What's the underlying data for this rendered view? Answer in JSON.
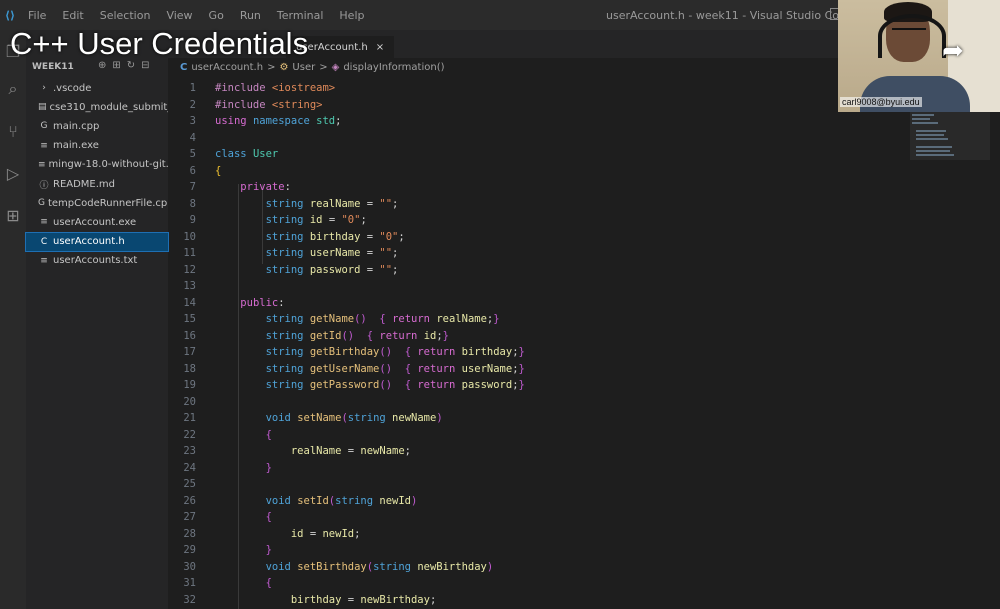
{
  "menu": [
    "File",
    "Edit",
    "Selection",
    "View",
    "Go",
    "Run",
    "Terminal",
    "Help"
  ],
  "window_title": "userAccount.h - week11 - Visual Studio Code",
  "overlay_title": "C++ User Credentials",
  "tab": {
    "label": "userAccount.h",
    "close": "×"
  },
  "breadcrumb": {
    "file": "userAccount.h",
    "sep": ">",
    "class": "User",
    "method": "displayInformation()"
  },
  "explorer": {
    "section": "WEEK11",
    "files": [
      {
        "name": ".vscode",
        "icon": "›"
      },
      {
        "name": "cse310_module_submit_c...",
        "icon": "▤"
      },
      {
        "name": "main.cpp",
        "icon": "G"
      },
      {
        "name": "main.exe",
        "icon": "≡"
      },
      {
        "name": "mingw-18.0-without-git...",
        "icon": "≡"
      },
      {
        "name": "README.md",
        "icon": "ⓘ"
      },
      {
        "name": "tempCodeRunnerFile.cpp",
        "icon": "G"
      },
      {
        "name": "userAccount.exe",
        "icon": "≡"
      },
      {
        "name": "userAccount.h",
        "icon": "C",
        "selected": true
      },
      {
        "name": "userAccounts.txt",
        "icon": "≡"
      }
    ]
  },
  "code_lines": [
    {
      "n": "1",
      "html": [
        [
          "pp",
          "#include "
        ],
        [
          "str",
          "<iostream>"
        ]
      ]
    },
    {
      "n": "2",
      "html": [
        [
          "pp",
          "#include "
        ],
        [
          "str",
          "<string>"
        ]
      ]
    },
    {
      "n": "3",
      "html": [
        [
          "kw",
          "using "
        ],
        [
          "ty",
          "namespace "
        ],
        [
          "cls",
          "std"
        ],
        [
          "plain",
          ";"
        ]
      ]
    },
    {
      "n": "4",
      "html": []
    },
    {
      "n": "5",
      "html": [
        [
          "ty",
          "class "
        ],
        [
          "cls",
          "User"
        ]
      ]
    },
    {
      "n": "6",
      "html": [
        [
          "br",
          "{"
        ]
      ]
    },
    {
      "n": "7",
      "html": [
        [
          "plain",
          "    "
        ],
        [
          "kw",
          "private"
        ],
        [
          "plain",
          ":"
        ]
      ]
    },
    {
      "n": "8",
      "html": [
        [
          "plain",
          "        "
        ],
        [
          "ty",
          "string "
        ],
        [
          "var",
          "realName"
        ],
        [
          "plain",
          " = "
        ],
        [
          "str",
          "\"\""
        ],
        [
          "plain",
          ";"
        ]
      ]
    },
    {
      "n": "9",
      "html": [
        [
          "plain",
          "        "
        ],
        [
          "ty",
          "string "
        ],
        [
          "var",
          "id"
        ],
        [
          "plain",
          " = "
        ],
        [
          "str",
          "\"0\""
        ],
        [
          "plain",
          ";"
        ]
      ]
    },
    {
      "n": "10",
      "html": [
        [
          "plain",
          "        "
        ],
        [
          "ty",
          "string "
        ],
        [
          "var",
          "birthday"
        ],
        [
          "plain",
          " = "
        ],
        [
          "str",
          "\"0\""
        ],
        [
          "plain",
          ";"
        ]
      ]
    },
    {
      "n": "11",
      "html": [
        [
          "plain",
          "        "
        ],
        [
          "ty",
          "string "
        ],
        [
          "var",
          "userName"
        ],
        [
          "plain",
          " = "
        ],
        [
          "str",
          "\"\""
        ],
        [
          "plain",
          ";"
        ]
      ]
    },
    {
      "n": "12",
      "html": [
        [
          "plain",
          "        "
        ],
        [
          "ty",
          "string "
        ],
        [
          "var",
          "password"
        ],
        [
          "plain",
          " = "
        ],
        [
          "str",
          "\"\""
        ],
        [
          "plain",
          ";"
        ]
      ]
    },
    {
      "n": "13",
      "html": []
    },
    {
      "n": "14",
      "html": [
        [
          "plain",
          "    "
        ],
        [
          "kw",
          "public"
        ],
        [
          "plain",
          ":"
        ]
      ]
    },
    {
      "n": "15",
      "html": [
        [
          "plain",
          "        "
        ],
        [
          "ty",
          "string "
        ],
        [
          "fn",
          "getName"
        ],
        [
          "br2",
          "()"
        ],
        [
          "plain",
          "  "
        ],
        [
          "br2",
          "{ "
        ],
        [
          "kw",
          "return "
        ],
        [
          "var",
          "realName"
        ],
        [
          "plain",
          ";"
        ],
        [
          "br2",
          "}"
        ]
      ]
    },
    {
      "n": "16",
      "html": [
        [
          "plain",
          "        "
        ],
        [
          "ty",
          "string "
        ],
        [
          "fn",
          "getId"
        ],
        [
          "br2",
          "()"
        ],
        [
          "plain",
          "  "
        ],
        [
          "br2",
          "{ "
        ],
        [
          "kw",
          "return "
        ],
        [
          "var",
          "id"
        ],
        [
          "plain",
          ";"
        ],
        [
          "br2",
          "}"
        ]
      ]
    },
    {
      "n": "17",
      "html": [
        [
          "plain",
          "        "
        ],
        [
          "ty",
          "string "
        ],
        [
          "fn",
          "getBirthday"
        ],
        [
          "br2",
          "()"
        ],
        [
          "plain",
          "  "
        ],
        [
          "br2",
          "{ "
        ],
        [
          "kw",
          "return "
        ],
        [
          "var",
          "birthday"
        ],
        [
          "plain",
          ";"
        ],
        [
          "br2",
          "}"
        ]
      ]
    },
    {
      "n": "18",
      "html": [
        [
          "plain",
          "        "
        ],
        [
          "ty",
          "string "
        ],
        [
          "fn",
          "getUserName"
        ],
        [
          "br2",
          "()"
        ],
        [
          "plain",
          "  "
        ],
        [
          "br2",
          "{ "
        ],
        [
          "kw",
          "return "
        ],
        [
          "var",
          "userName"
        ],
        [
          "plain",
          ";"
        ],
        [
          "br2",
          "}"
        ]
      ]
    },
    {
      "n": "19",
      "html": [
        [
          "plain",
          "        "
        ],
        [
          "ty",
          "string "
        ],
        [
          "fn",
          "getPassword"
        ],
        [
          "br2",
          "()"
        ],
        [
          "plain",
          "  "
        ],
        [
          "br2",
          "{ "
        ],
        [
          "kw",
          "return "
        ],
        [
          "var",
          "password"
        ],
        [
          "plain",
          ";"
        ],
        [
          "br2",
          "}"
        ]
      ]
    },
    {
      "n": "20",
      "html": []
    },
    {
      "n": "21",
      "html": [
        [
          "plain",
          "        "
        ],
        [
          "ty",
          "void "
        ],
        [
          "fn",
          "setName"
        ],
        [
          "br2",
          "("
        ],
        [
          "ty",
          "string "
        ],
        [
          "var",
          "newName"
        ],
        [
          "br2",
          ")"
        ]
      ]
    },
    {
      "n": "22",
      "html": [
        [
          "plain",
          "        "
        ],
        [
          "br2",
          "{"
        ]
      ]
    },
    {
      "n": "23",
      "html": [
        [
          "plain",
          "            "
        ],
        [
          "var",
          "realName"
        ],
        [
          "plain",
          " = "
        ],
        [
          "var",
          "newName"
        ],
        [
          "plain",
          ";"
        ]
      ]
    },
    {
      "n": "24",
      "html": [
        [
          "plain",
          "        "
        ],
        [
          "br2",
          "}"
        ]
      ]
    },
    {
      "n": "25",
      "html": []
    },
    {
      "n": "26",
      "html": [
        [
          "plain",
          "        "
        ],
        [
          "ty",
          "void "
        ],
        [
          "fn",
          "setId"
        ],
        [
          "br2",
          "("
        ],
        [
          "ty",
          "string "
        ],
        [
          "var",
          "newId"
        ],
        [
          "br2",
          ")"
        ]
      ]
    },
    {
      "n": "27",
      "html": [
        [
          "plain",
          "        "
        ],
        [
          "br2",
          "{"
        ]
      ]
    },
    {
      "n": "28",
      "html": [
        [
          "plain",
          "            "
        ],
        [
          "var",
          "id"
        ],
        [
          "plain",
          " = "
        ],
        [
          "var",
          "newId"
        ],
        [
          "plain",
          ";"
        ]
      ]
    },
    {
      "n": "29",
      "html": [
        [
          "plain",
          "        "
        ],
        [
          "br2",
          "}"
        ]
      ]
    },
    {
      "n": "30",
      "html": [
        [
          "plain",
          "        "
        ],
        [
          "ty",
          "void "
        ],
        [
          "fn",
          "setBirthday"
        ],
        [
          "br2",
          "("
        ],
        [
          "ty",
          "string "
        ],
        [
          "var",
          "newBirthday"
        ],
        [
          "br2",
          ")"
        ]
      ]
    },
    {
      "n": "31",
      "html": [
        [
          "plain",
          "        "
        ],
        [
          "br2",
          "{"
        ]
      ]
    },
    {
      "n": "32",
      "html": [
        [
          "plain",
          "            "
        ],
        [
          "var",
          "birthday"
        ],
        [
          "plain",
          " = "
        ],
        [
          "var",
          "newBirthday"
        ],
        [
          "plain",
          ";"
        ]
      ]
    }
  ],
  "webcam": {
    "label": "carl9008@byui.edu"
  },
  "colors": {
    "accent": "#094771",
    "editor_bg": "#1e1e1e",
    "sidebar_bg": "#252526"
  }
}
